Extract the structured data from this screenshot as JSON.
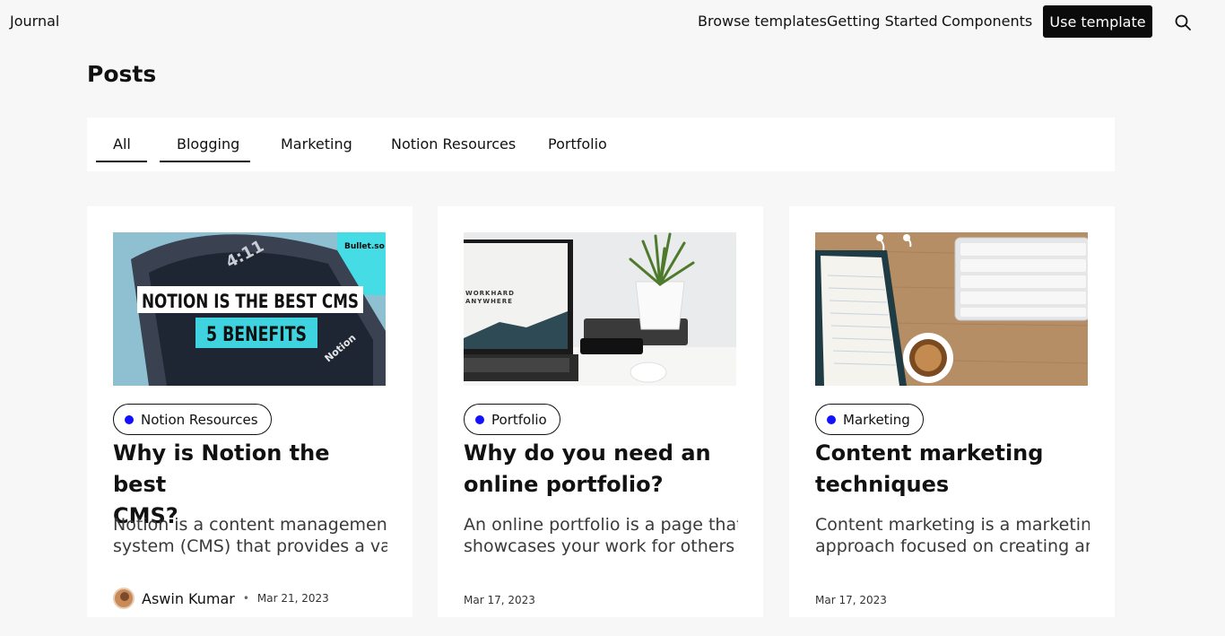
{
  "header": {
    "brand": "Journal",
    "nav": [
      "Browse templates",
      "Getting Started",
      "Components"
    ],
    "cta_label": "Use template",
    "search_icon": "search-icon"
  },
  "page": {
    "title": "Posts"
  },
  "tabs": {
    "items": [
      "All",
      "Blogging",
      "Marketing",
      "Notion Resources",
      "Portfolio"
    ],
    "selected": "All"
  },
  "posts": [
    {
      "image_text": {
        "brand": "Bullet.so",
        "time": "4:11",
        "headline": "NOTION IS THE BEST CMS",
        "subheadline": "5 BENEFITS",
        "product": "Notion"
      },
      "category": "Notion Resources",
      "title_lines": [
        "Why is Notion the best",
        "CMS?"
      ],
      "excerpt_lines": [
        "Notion is a content management",
        "system (CMS) that provides a variet..."
      ],
      "author": "Aswin Kumar",
      "date": "Mar 21, 2023"
    },
    {
      "image_text": {
        "screen_line1": "WORKHARD",
        "screen_line2": "ANYWHERE"
      },
      "category": "Portfolio",
      "title_lines": [
        "Why do you need an",
        "online portfolio?"
      ],
      "excerpt_lines": [
        "An online portfolio is a page that",
        "showcases your work for others to..."
      ],
      "date": "Mar 17, 2023"
    },
    {
      "category": "Marketing",
      "title_lines": [
        "Content marketing",
        "techniques"
      ],
      "excerpt_lines": [
        "Content marketing is a marketing",
        "approach focused on creating and..."
      ],
      "date": "Mar 17, 2023"
    }
  ],
  "colors": {
    "page_bg": "#f7f7f7",
    "category_dot": "#1111ff",
    "cta_bg": "#0b0b0b"
  }
}
